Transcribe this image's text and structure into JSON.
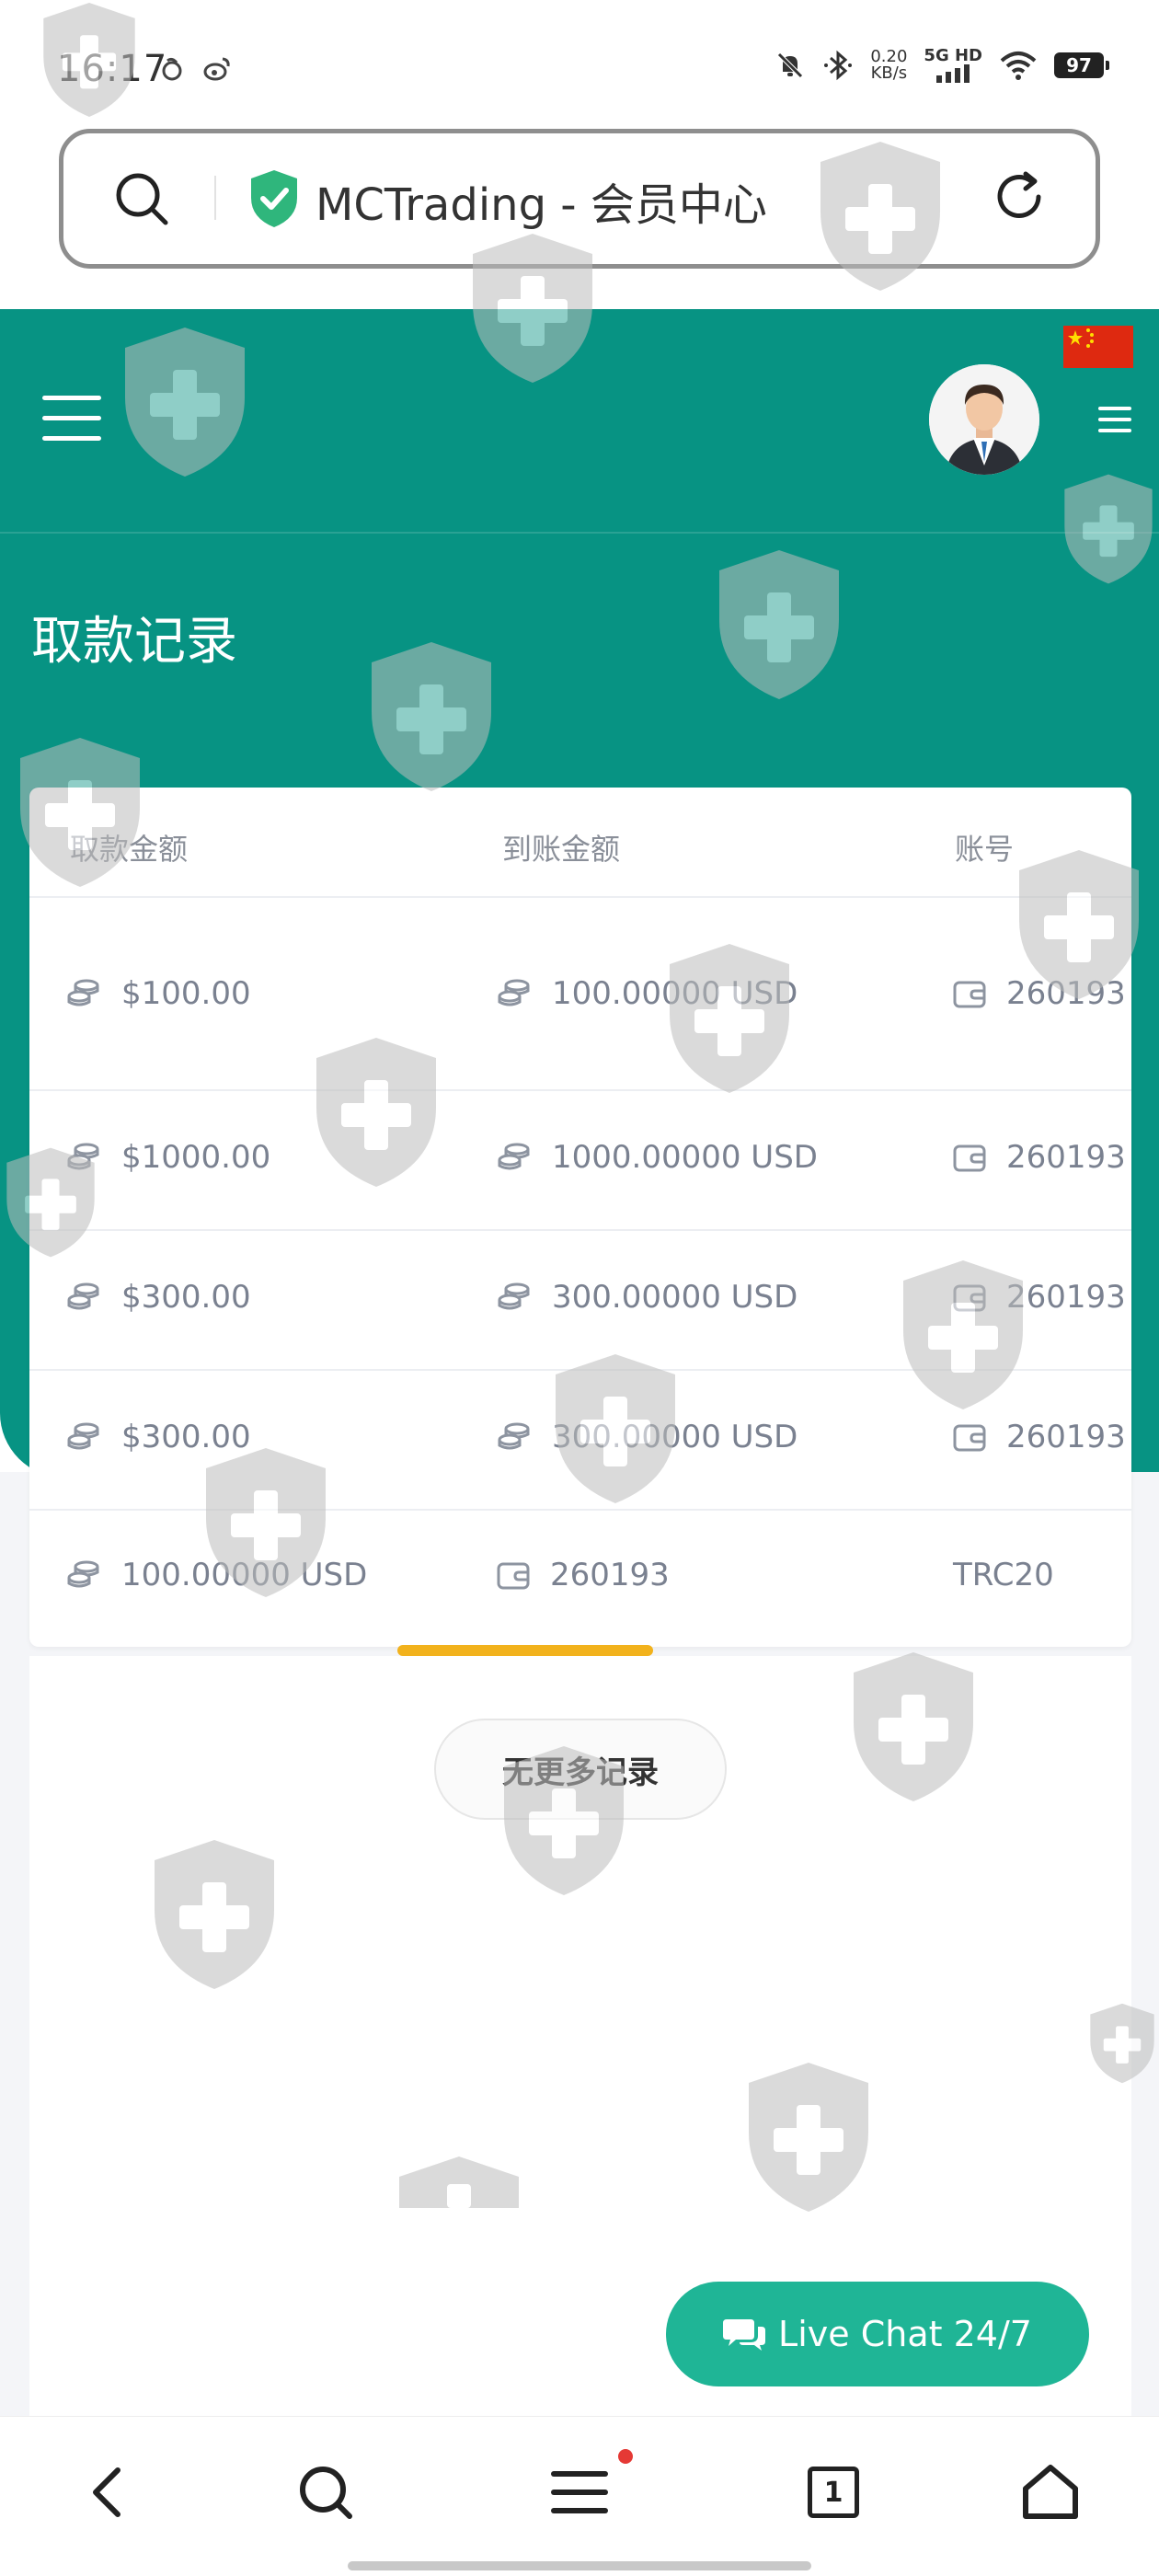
{
  "status_bar": {
    "time": "16:17",
    "speed_value": "0.20",
    "speed_unit": "KB/s",
    "network": "5G HD",
    "battery": "97"
  },
  "address_bar": {
    "site_title": "MCTrading - 会员中心"
  },
  "header": {
    "page_title": "取款记录"
  },
  "table": {
    "columns": [
      "取款金额",
      "到账金额",
      "账号"
    ],
    "rows": [
      {
        "amount": "$100.00",
        "received": "100.00000 USD",
        "account": "260193"
      },
      {
        "amount": "$1000.00",
        "received": "1000.00000 USD",
        "account": "260193"
      },
      {
        "amount": "$300.00",
        "received": "300.00000 USD",
        "account": "260193"
      },
      {
        "amount": "$300.00",
        "received": "300.00000 USD",
        "account": "260193"
      },
      {
        "amount": "100.00000 USD",
        "received": "260193",
        "account": "TRC20"
      }
    ]
  },
  "no_more_label": "无更多记录",
  "live_chat_label": "Live Chat 24/7",
  "nav": {
    "tab_count": "1"
  },
  "colors": {
    "teal": "#079383",
    "live_chat": "#1fb596",
    "scroll_indicator": "#f2b21c",
    "badge_green": "#2fb67c"
  },
  "icons": {
    "amount": "coin-stack-icon",
    "account": "wallet-icon",
    "chat": "chat-bubbles-icon"
  }
}
